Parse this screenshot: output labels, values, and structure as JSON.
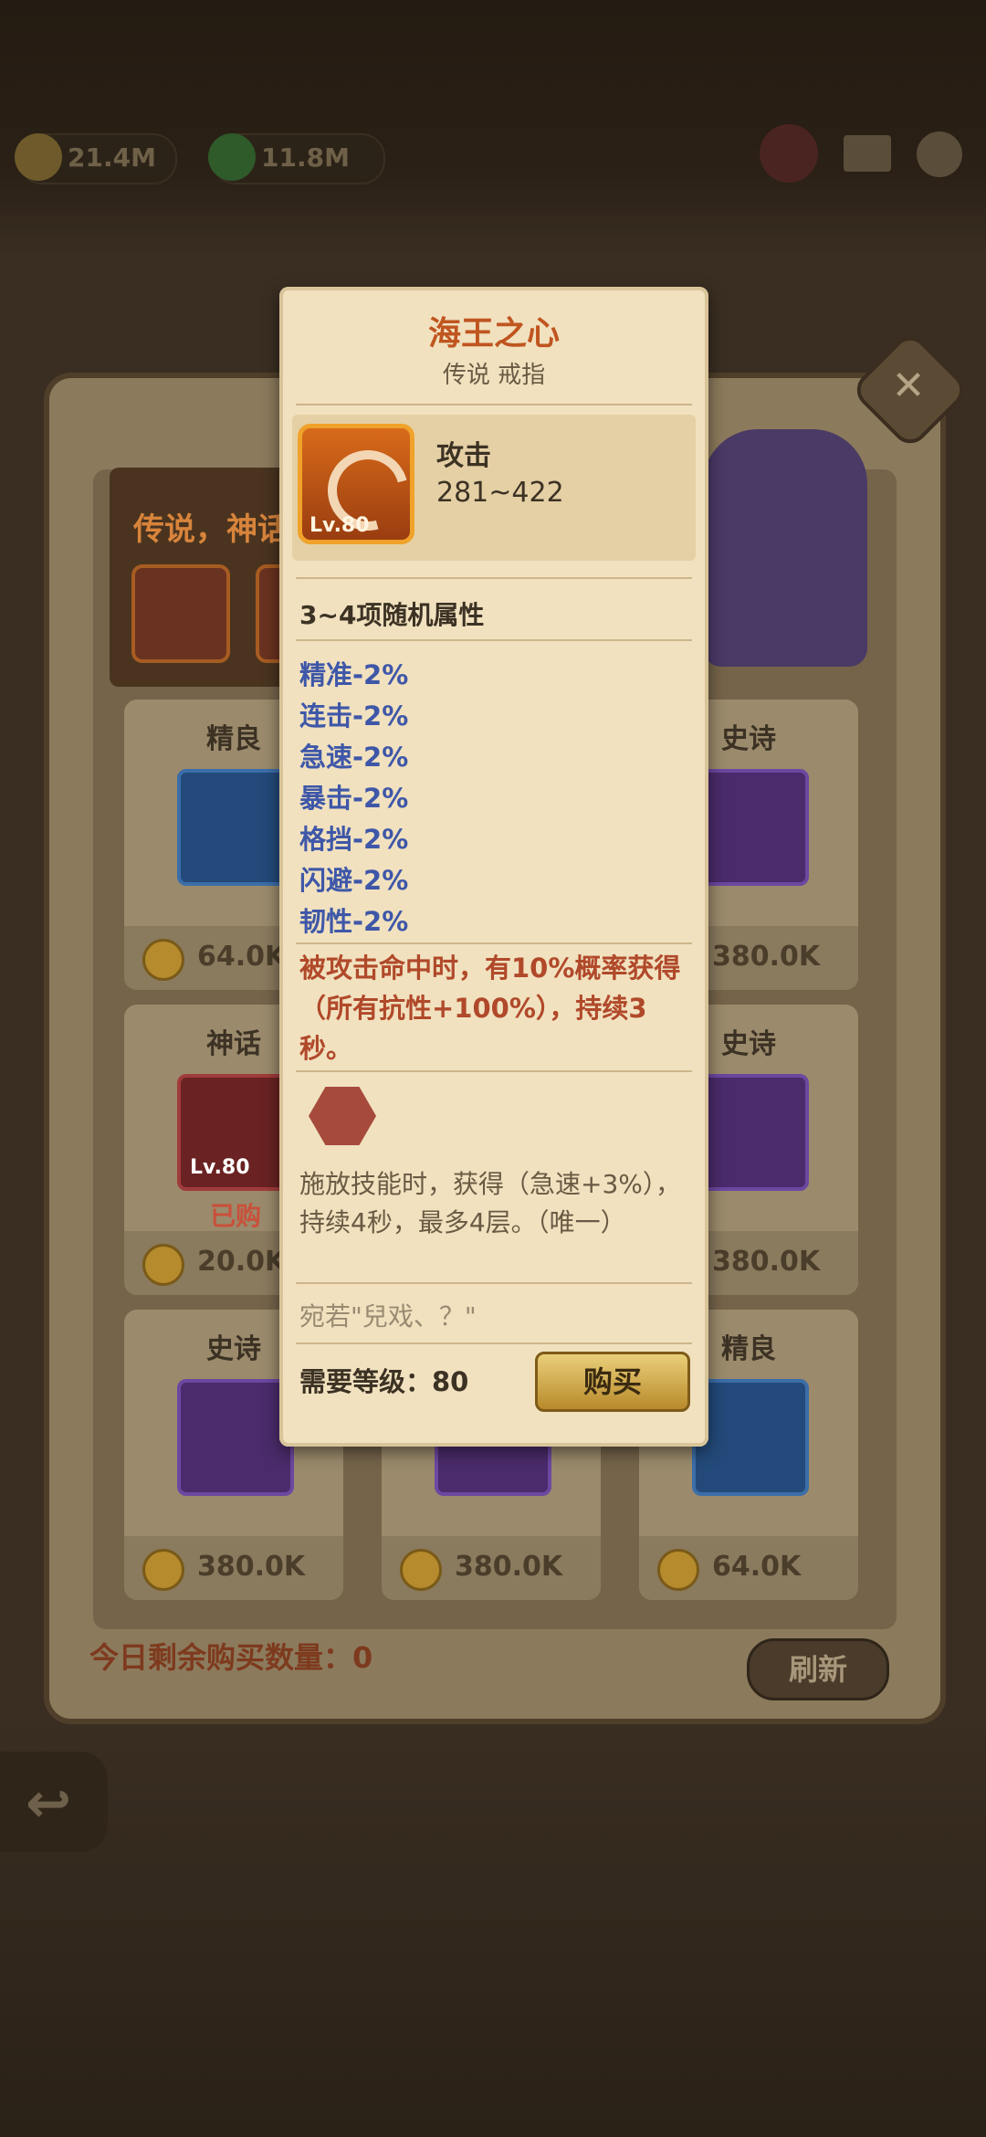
{
  "topbar": {
    "gold": "21.4M",
    "gems": "11.8M"
  },
  "shop": {
    "banner_text": "传说，神话",
    "daily_remaining": "今日剩余购买数量：0",
    "refresh_label": "刷新",
    "cards": [
      {
        "rarity": "精良",
        "price": "64.0K"
      },
      {
        "rarity": "史诗",
        "price": "380.0K"
      },
      {
        "rarity": "神话",
        "price": "20.0K",
        "level": "Lv.80",
        "tag": "已购"
      },
      {
        "rarity": "史诗",
        "price": "380.0K"
      },
      {
        "rarity": "史诗",
        "price": "380.0K"
      },
      {
        "rarity": "",
        "price": "380.0K"
      },
      {
        "rarity": "精良",
        "price": "64.0K"
      }
    ]
  },
  "tooltip": {
    "title": "海王之心",
    "subtitle": "传说 戒指",
    "item_level": "Lv.80",
    "stat_label": "攻击",
    "stat_value": "281~422",
    "random_header": "3~4项随机属性",
    "attributes": [
      "精准-2%",
      "连击-2%",
      "急速-2%",
      "暴击-2%",
      "格挡-2%",
      "闪避-2%",
      "韧性-2%"
    ],
    "effect": "被攻击命中时，有10%概率获得（所有抗性+100%），持续3秒。",
    "skill": "施放技能时，获得（急速+3%），持续4秒，最多4层。（唯一）",
    "quote": "宛若\"兒戏、？\"",
    "required_level": "需要等级：80",
    "buy_label": "购买"
  },
  "colors": {
    "title_orange": "#c0551f",
    "attribute_blue": "#3e57a8",
    "effect_red": "#b0492a"
  }
}
